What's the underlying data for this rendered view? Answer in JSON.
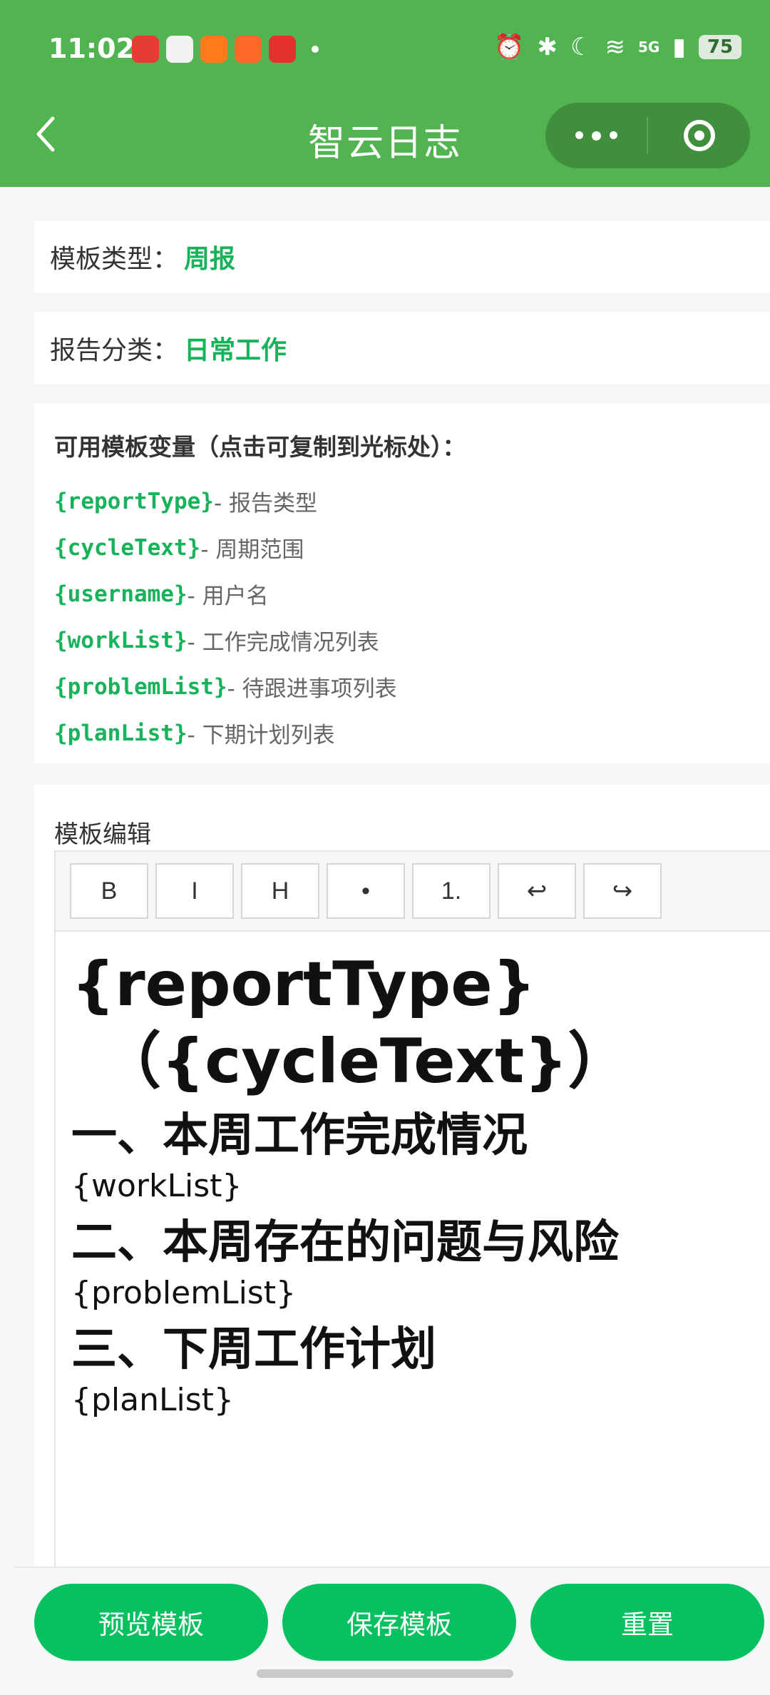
{
  "status_bar": {
    "time": "11:02",
    "battery": "75",
    "network": "5G"
  },
  "nav": {
    "title": "智云日志"
  },
  "template_type": {
    "label": "模板类型：",
    "value": "周报"
  },
  "report_category": {
    "label": "报告分类：",
    "value": "日常工作"
  },
  "variables": {
    "title": "可用模板变量（点击可复制到光标处）：",
    "items": [
      {
        "code": "{reportType}",
        "desc": "- 报告类型"
      },
      {
        "code": "{cycleText}",
        "desc": "- 周期范围"
      },
      {
        "code": "{username}",
        "desc": "- 用户名"
      },
      {
        "code": "{workList}",
        "desc": "- 工作完成情况列表"
      },
      {
        "code": "{problemList}",
        "desc": "- 待跟进事项列表"
      },
      {
        "code": "{planList}",
        "desc": "- 下期计划列表"
      }
    ]
  },
  "editor": {
    "label": "模板编辑",
    "toolbar": [
      "B",
      "I",
      "H",
      "•",
      "1.",
      "↩",
      "↪"
    ],
    "content": {
      "heading_line1": "{reportType}",
      "heading_line2": "（{cycleText}）",
      "section1_title": "一、本周工作完成情况",
      "section1_body": "{workList}",
      "section2_title": "二、本周存在的问题与风险",
      "section2_body": "{problemList}",
      "section3_title": "三、下周工作计划",
      "section3_body": "{planList}"
    }
  },
  "actions": {
    "preview": "预览模板",
    "save": "保存模板",
    "reset": "重置"
  },
  "colors": {
    "header": "#52b451",
    "accent": "#17b35b",
    "button": "#07c160"
  }
}
